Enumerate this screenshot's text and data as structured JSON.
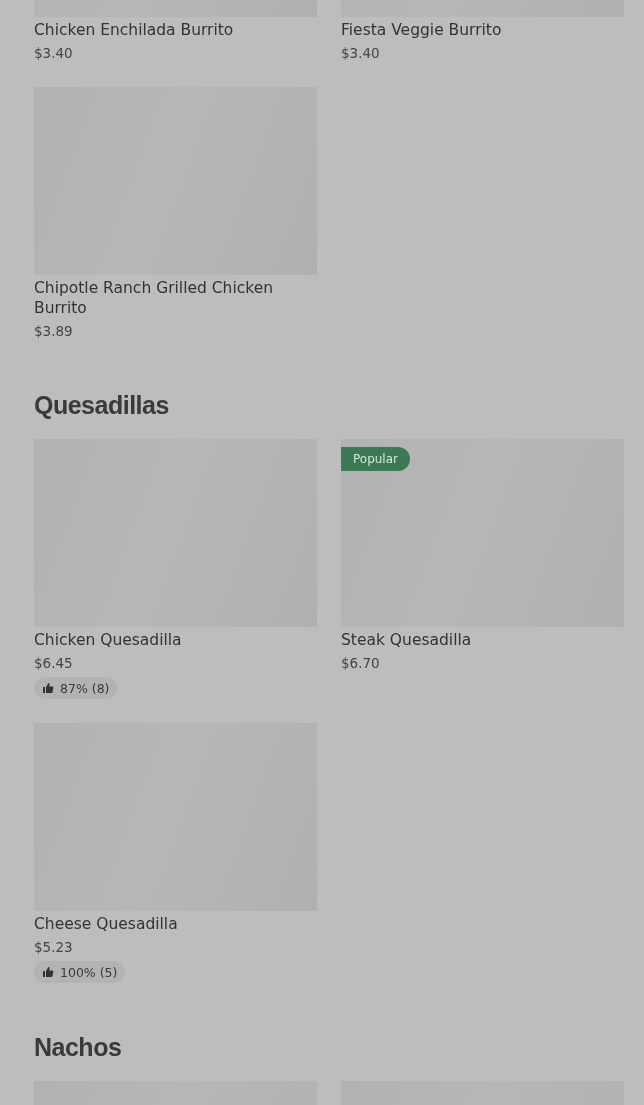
{
  "sections": [
    {
      "items": [
        {
          "kind": "dish",
          "name": "Chicken Enchilada Burrito",
          "price": "$3.40"
        },
        {
          "kind": "dish",
          "name": "Fiesta Veggie Burrito",
          "price": "$3.40"
        },
        {
          "kind": "dish",
          "name": "Chipotle Ranch Grilled Chicken Burrito",
          "price": "$3.89"
        }
      ]
    },
    {
      "title": "Quesadillas",
      "items": [
        {
          "kind": "dish",
          "name": "Chicken Quesadilla",
          "price": "$6.45",
          "rating": "87% (8)"
        },
        {
          "kind": "dish",
          "name": "Steak Quesadilla",
          "price": "$6.70",
          "badge": "Popular"
        },
        {
          "kind": "dish",
          "name": "Cheese Quesadilla",
          "price": "$5.23",
          "rating": "100% (5)"
        }
      ]
    },
    {
      "title": "Nachos",
      "items": [
        {
          "kind": "image"
        },
        {
          "kind": "image"
        }
      ]
    }
  ]
}
